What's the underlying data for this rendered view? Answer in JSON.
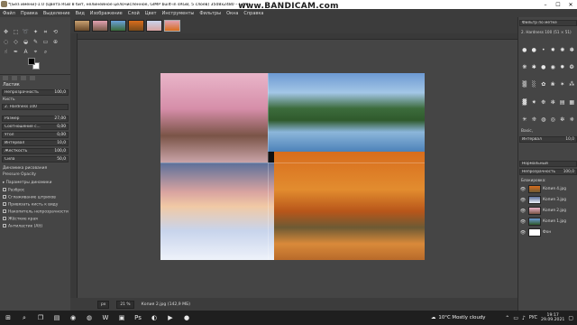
{
  "titlebar": {
    "title": "*[Без имени]-1.0 (Цвета RGB 8 бит, нелинейное целочисленное, GIMP built-in sRGB, 5 слоёв) 3508x2480 – GIMP",
    "minimize": "–",
    "maximize": "☐",
    "close": "✕"
  },
  "watermark": {
    "text": "www.BANDICAM.com"
  },
  "menubar": {
    "items": [
      "Файл",
      "Правка",
      "Выделение",
      "Вид",
      "Изображение",
      "Слой",
      "Цвет",
      "Инструменты",
      "Фильтры",
      "Окна",
      "Справка"
    ]
  },
  "tool_options": {
    "title": "Ластик",
    "opacity_label": "Непрозрачность",
    "opacity_value": "100,0",
    "brush_label": "Кисть",
    "brush_value": "2. Hardness 100",
    "size_label": "Размер",
    "size_value": "27,00",
    "aspect_label": "Соотношение с...",
    "aspect_value": "0,00",
    "angle_label": "Угол",
    "angle_value": "0,00",
    "spacing_label": "Интервал",
    "spacing_value": "10,0",
    "hardness_label": "Жёсткость",
    "hardness_value": "100,0",
    "force_label": "Сила",
    "force_value": "50,0",
    "dynamics_label": "Динамика рисования",
    "dynamics_value": "Pressure Opacity",
    "dynamics_params": "Параметры динамики",
    "scatter": "Разброс",
    "smooth": "Сглаживание штрихов",
    "lock_brush": "Привязать кисть к виду",
    "incremental": "Накопитель непрозрачности",
    "hard_edge": "Жёсткие края",
    "anti_erase": "Антиластик (Alt)"
  },
  "statusbar": {
    "unit": "px",
    "zoom": "21 %",
    "info": "Копия 2.jpg (142,9 МБ)"
  },
  "right_panel": {
    "brush_filter": "Фильтр по метке",
    "brush_name": "2. Hardness 100 (51 × 51)",
    "basic_label": "Basic,",
    "spacing_label": "Интервал",
    "spacing_value": "10,0",
    "mode_label": "Режим",
    "mode_value": "Нормальный",
    "opacity_label": "Непрозрачность",
    "opacity_value": "100,0",
    "lock_label": "Блокировка:"
  },
  "layers": [
    {
      "name": "Копия 4.jpg"
    },
    {
      "name": "Копия 3.jpg"
    },
    {
      "name": "Копия 2.jpg"
    },
    {
      "name": "Копия 1.jpg"
    },
    {
      "name": "Фон"
    }
  ],
  "taskbar": {
    "weather": "10°C  Mostly cloudy",
    "lang": "РУС",
    "time": "19:17",
    "date": "29.09.2021"
  },
  "colors": {
    "panel": "#454545",
    "menubar": "#3c3c3c",
    "taskbar": "#1f1f1f"
  }
}
